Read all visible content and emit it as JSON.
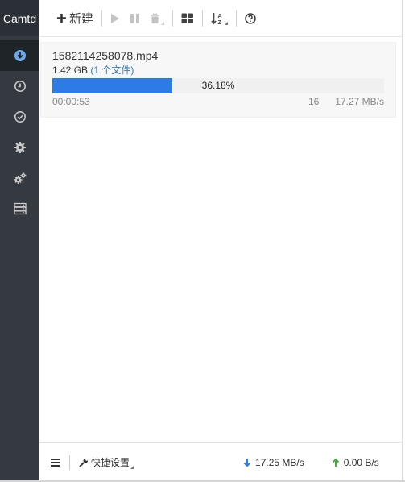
{
  "app": {
    "brand": "Camtd"
  },
  "sidebar": {
    "items": [
      {
        "name": "downloading",
        "icon": "download-circle-icon",
        "active": true
      },
      {
        "name": "waiting",
        "icon": "clock-icon",
        "active": false
      },
      {
        "name": "stopped",
        "icon": "check-circle-icon",
        "active": false
      },
      {
        "name": "settings",
        "icon": "gear-icon",
        "active": false
      },
      {
        "name": "advanced-settings",
        "icon": "gears-icon",
        "active": false
      },
      {
        "name": "server-status",
        "icon": "server-icon",
        "active": false
      }
    ]
  },
  "toolbar": {
    "new_label": "新建",
    "icons": [
      "plus-icon",
      "play-icon",
      "pause-icon",
      "trash-icon",
      "grid-icon",
      "sort-az-icon",
      "help-icon"
    ]
  },
  "tasks": [
    {
      "name": "1582114258078.mp4",
      "size": "1.42 GB",
      "files": "(1 个文件)",
      "progress_percent": 36.18,
      "progress_text": "36.18%",
      "elapsed": "00:00:53",
      "connections": "16",
      "speed": "17.27 MB/s"
    }
  ],
  "footer": {
    "quick_settings": "快捷设置",
    "download_speed": "17.25 MB/s",
    "upload_speed": "0.00 B/s"
  },
  "colors": {
    "sidebar_bg": "#343a40",
    "progress": "#2d7be5",
    "download_arrow": "#2d7be5",
    "upload_arrow": "#3bb33b"
  }
}
